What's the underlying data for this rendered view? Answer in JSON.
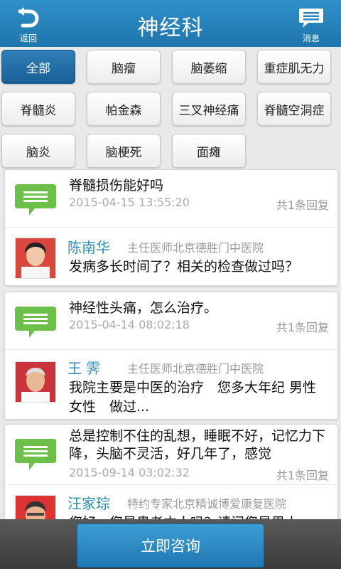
{
  "header": {
    "title": "神经科",
    "back_label": "返回",
    "message_label": "消息"
  },
  "categories": [
    "全部",
    "脑瘤",
    "脑萎缩",
    "重症肌无力",
    "脊髓炎",
    "帕金森",
    "三叉神经痛",
    "脊髓空洞症",
    "脑炎",
    "脑梗死",
    "面瘫"
  ],
  "active_category": "全部",
  "questions": [
    {
      "question": "脊髓损伤能好吗",
      "date": "2015-04-15 13:55:20",
      "replies": "共1条回复",
      "doctor_name": "陈南华",
      "doctor_title": "主任医师北京德胜门中医院",
      "answer": "发病多长时间了？相关的检查做过吗？"
    },
    {
      "question": "神经性头痛，怎么治疗。",
      "date": "2015-04-14 08:02:18",
      "replies": "共1条回复",
      "doctor_name": "王 霁",
      "doctor_title": "主任医师北京德胜门中医院",
      "answer": "我院主要是中医的治疗　您多大年纪 男性女性　做过..."
    },
    {
      "question": "总是控制不住的乱想，睡眠不好，记忆力下降，头脑不灵活，好几年了，感觉",
      "date": "2015-09-14 03:02:32",
      "replies": "共1条回复",
      "doctor_name": "汪家琮",
      "doctor_title": "特约专家北京精诚博爱康复医院",
      "answer": "您好，您是患者本人吗？请问您是男士..."
    }
  ],
  "consult_button": "立即咨询",
  "colors": {
    "header": "#2a86c0",
    "accent": "#2a8fb3",
    "bubble": "#6cc04a"
  }
}
